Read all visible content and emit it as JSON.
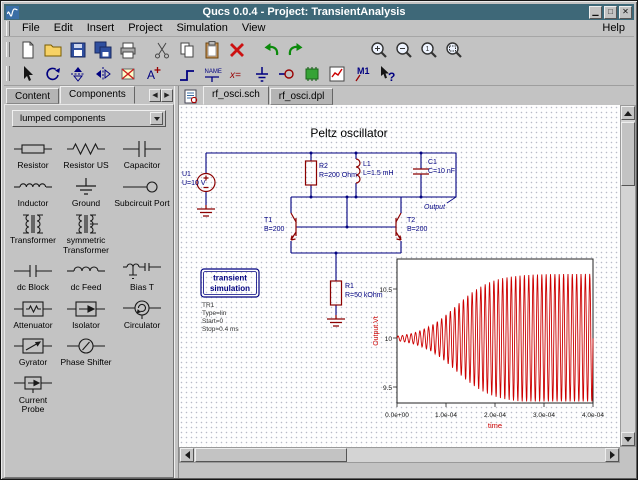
{
  "window": {
    "title": "Qucs 0.0.4 - Project: TransientAnalysis"
  },
  "menubar": {
    "items": [
      "File",
      "Edit",
      "Insert",
      "Project",
      "Simulation",
      "View"
    ],
    "help": "Help"
  },
  "toolbar_file": {
    "icons": [
      "new-file",
      "open-folder",
      "save",
      "save-all",
      "print",
      "cut",
      "copy",
      "paste",
      "delete",
      "undo",
      "redo",
      "zoom-in",
      "zoom-out",
      "zoom-one",
      "zoom-fit"
    ]
  },
  "toolbar_edit": {
    "icons": [
      "select-pointer",
      "rotate",
      "mirror-x",
      "mirror-y",
      "deactivate",
      "move-text",
      "wire",
      "wire-label",
      "equation",
      "ground",
      "port",
      "simulate",
      "view-data",
      "marker",
      "whats-this"
    ],
    "marker_label": "M1",
    "name_icon_text": "NAME"
  },
  "sidebar": {
    "tabs": [
      {
        "label": "Content"
      },
      {
        "label": "Components"
      }
    ],
    "active_tab": "Components",
    "category_select": "lumped components",
    "components": [
      {
        "label": "Resistor",
        "icon": "resistor-eu-icon"
      },
      {
        "label": "Resistor US",
        "icon": "resistor-us-icon"
      },
      {
        "label": "Capacitor",
        "icon": "capacitor-icon"
      },
      {
        "label": "Inductor",
        "icon": "inductor-icon"
      },
      {
        "label": "Ground",
        "icon": "ground-icon"
      },
      {
        "label": "Subcircuit Port",
        "icon": "port-icon"
      },
      {
        "label": "Transformer",
        "icon": "transformer-icon"
      },
      {
        "label": "symmetric Transformer",
        "icon": "sym-transformer-icon"
      },
      {
        "label": "dc Block",
        "icon": "dc-block-icon"
      },
      {
        "label": "dc Feed",
        "icon": "dc-feed-icon"
      },
      {
        "label": "Bias T",
        "icon": "bias-t-icon"
      },
      {
        "label": "Attenuator",
        "icon": "attenuator-icon"
      },
      {
        "label": "Isolator",
        "icon": "isolator-icon"
      },
      {
        "label": "Circulator",
        "icon": "circulator-icon"
      },
      {
        "label": "Gyrator",
        "icon": "gyrator-icon"
      },
      {
        "label": "Phase Shifter",
        "icon": "phase-shifter-icon"
      },
      {
        "label": "Current Probe",
        "icon": "current-probe-icon"
      }
    ]
  },
  "document": {
    "tabs": [
      {
        "label": "rf_osci.sch"
      },
      {
        "label": "rf_osci.dpl"
      }
    ],
    "active_tab": "rf_osci.sch"
  },
  "schematic": {
    "title": "Peltz oscillator",
    "u1_name": "U1",
    "u1_value": "U=10 V",
    "r2_name": "R2",
    "r2_value": "R=200 Ohm",
    "l1_name": "L1",
    "l1_value": "L=1.5 mH",
    "c1_name": "C1",
    "c1_value": "C=10 nF",
    "t1_name": "T1",
    "t1_value": "B=200",
    "t2_name": "T2",
    "t2_value": "B=200",
    "r1_name": "R1",
    "r1_value": "R=50 kOhm",
    "node_label": "Output",
    "sim_line1": "transient",
    "sim_line2": "simulation",
    "sim_name": "TR1",
    "sim_prop1": "Type=lin",
    "sim_prop2": "Start=0",
    "sim_prop3": "Stop=0.4 ms"
  },
  "chart_data": {
    "type": "line",
    "xlabel": "time",
    "ylabel": "Output.Vt",
    "x_ticks": [
      "0.0e+00",
      "1.0e-04",
      "2.0e-04",
      "3.0e-04",
      "4.0e-04"
    ],
    "y_ticks": [
      "10.5",
      "10",
      "9.5"
    ],
    "x_range": [
      0,
      0.0004
    ],
    "y_range": [
      9.35,
      10.8
    ],
    "grid": false,
    "series": [
      {
        "name": "Output.Vt",
        "color": "#cc0000",
        "description": "Transient response: oscillation at ~112 kHz centered at 10 V with exponentially growing amplitude saturating near +/-0.65 V",
        "center": 10,
        "final_amplitude": 0.65,
        "cycles": 45,
        "growth_midpoint": 0.3,
        "growth_rate": 11
      }
    ]
  }
}
